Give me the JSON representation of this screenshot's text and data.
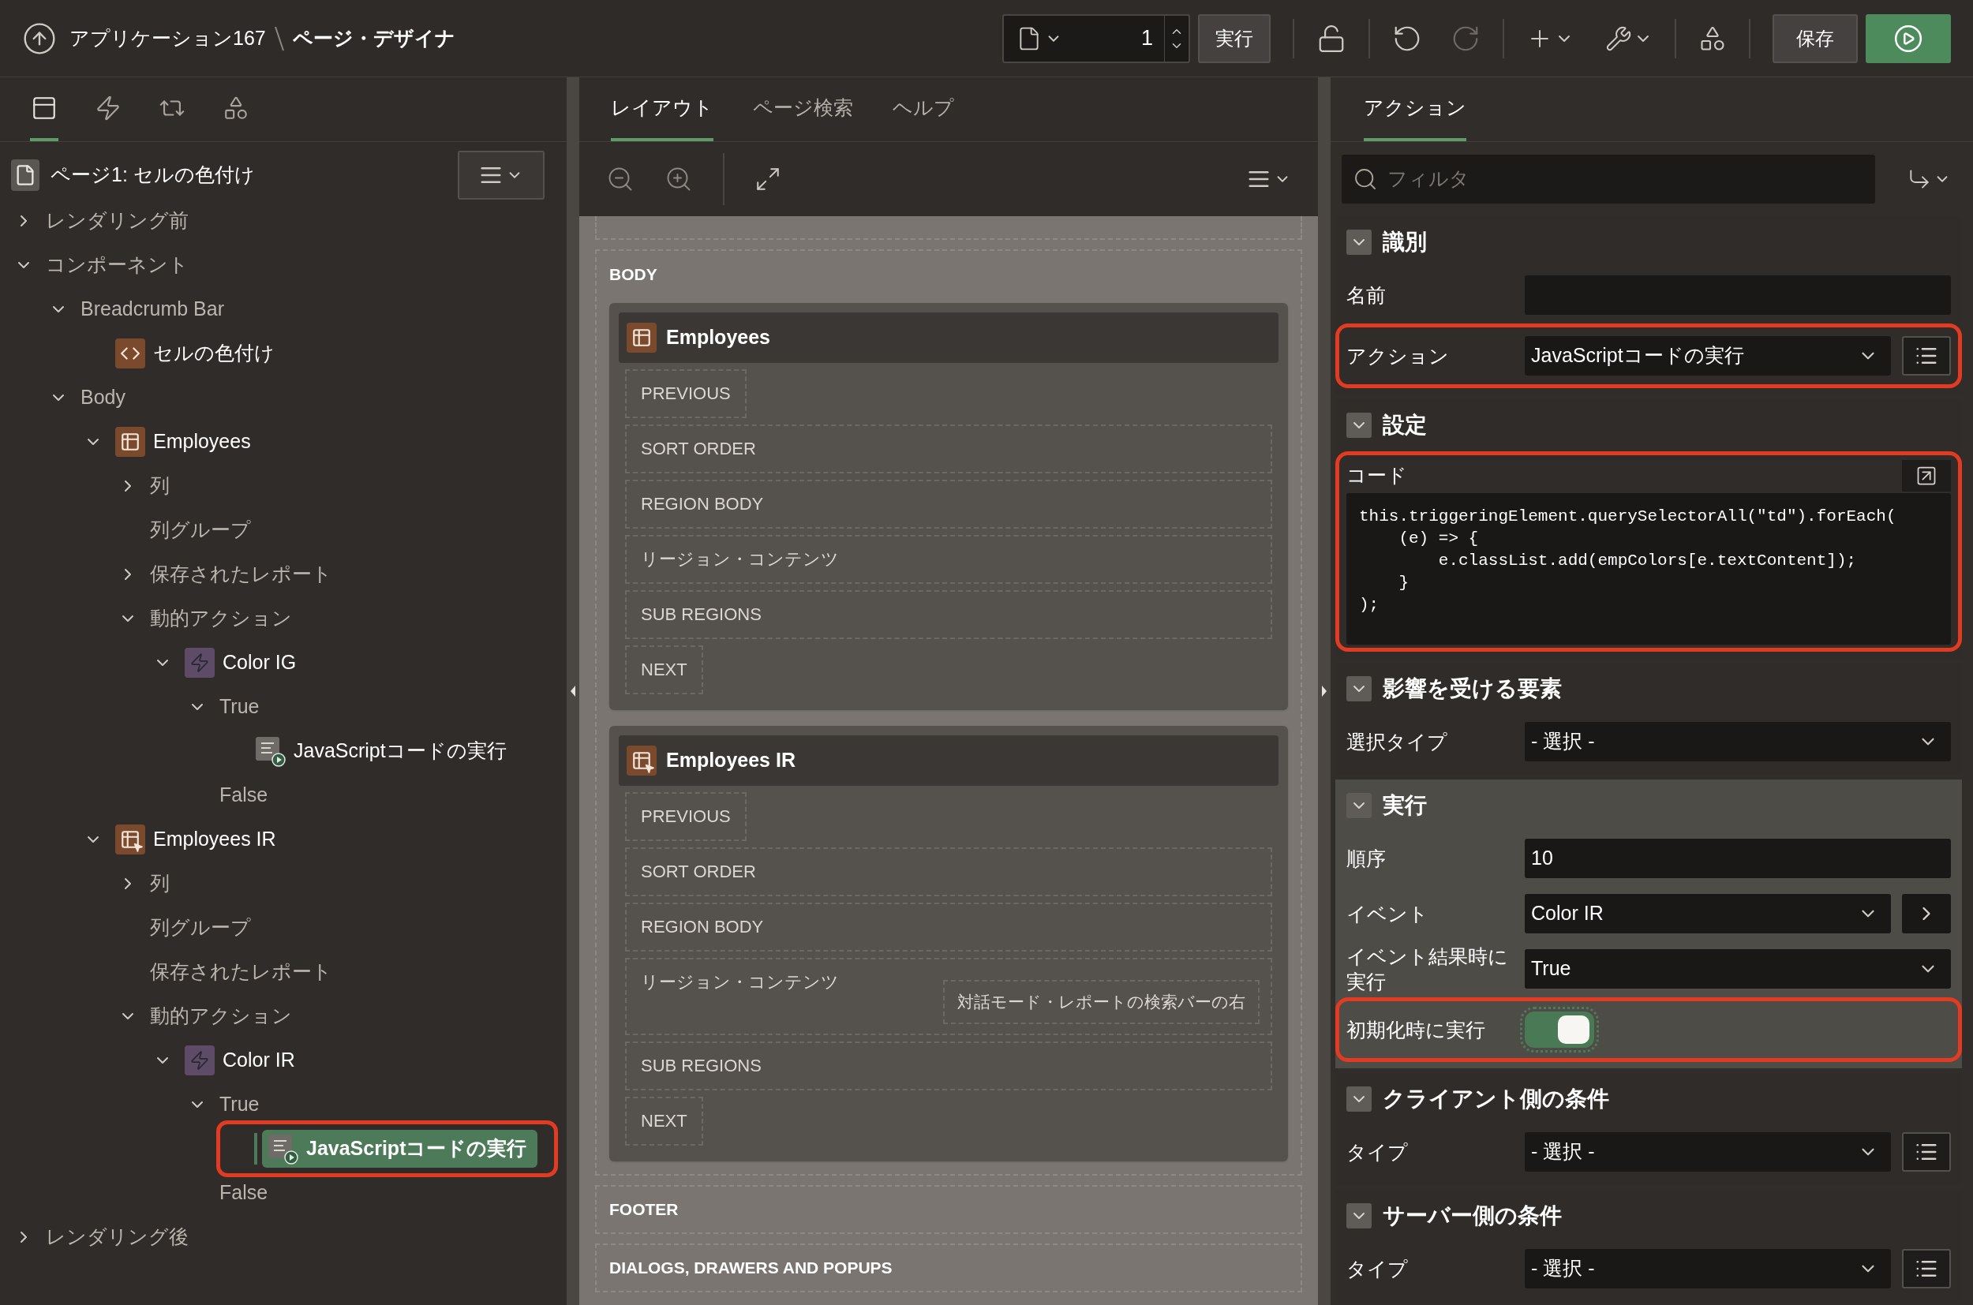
{
  "header": {
    "breadcrumb": [
      {
        "label": "アプリケーション167"
      },
      {
        "label": "ページ・デザイナ"
      }
    ],
    "page_number": "1",
    "run_label": "実行",
    "save_label": "保存"
  },
  "left_panel": {
    "tabs": [
      {
        "kind": "rendering",
        "selected": true
      },
      {
        "kind": "dynamic",
        "selected": false
      },
      {
        "kind": "processing",
        "selected": false
      },
      {
        "kind": "shared",
        "selected": false
      }
    ],
    "page_title": "ページ1: セルの色付け",
    "tree": [
      {
        "label": "レンダリング前",
        "kind": "plain",
        "expanded": false,
        "selected": false
      },
      {
        "label": "コンポーネント",
        "kind": "plain",
        "expanded": true,
        "selected": false,
        "children": [
          {
            "label": "Breadcrumb Bar",
            "kind": "plain",
            "expanded": true,
            "selected": false,
            "children": [
              {
                "label": "セルの色付け",
                "kind": "code",
                "selected": false
              }
            ]
          },
          {
            "label": "Body",
            "kind": "plain",
            "expanded": true,
            "selected": false,
            "children": [
              {
                "label": "Employees",
                "kind": "grid",
                "expanded": true,
                "selected": false,
                "children": [
                  {
                    "label": "列",
                    "kind": "plain",
                    "expanded": false,
                    "selected": false
                  },
                  {
                    "label": "列グループ",
                    "kind": "plain",
                    "selected": false
                  },
                  {
                    "label": "保存されたレポート",
                    "kind": "plain",
                    "expanded": false,
                    "selected": false
                  },
                  {
                    "label": "動的アクション",
                    "kind": "plain",
                    "expanded": true,
                    "selected": false,
                    "children": [
                      {
                        "label": "Color IG",
                        "kind": "action",
                        "expanded": true,
                        "selected": false,
                        "children": [
                          {
                            "label": "True",
                            "kind": "plain",
                            "expanded": true,
                            "selected": false,
                            "children": [
                              {
                                "label": "JavaScriptコードの実行",
                                "kind": "js",
                                "selected": false
                              }
                            ]
                          },
                          {
                            "label": "False",
                            "kind": "plain",
                            "selected": false
                          }
                        ]
                      }
                    ]
                  }
                ]
              },
              {
                "label": "Employees IR",
                "kind": "report",
                "expanded": true,
                "selected": false,
                "children": [
                  {
                    "label": "列",
                    "kind": "plain",
                    "expanded": false,
                    "selected": false
                  },
                  {
                    "label": "列グループ",
                    "kind": "plain",
                    "selected": false
                  },
                  {
                    "label": "保存されたレポート",
                    "kind": "plain",
                    "selected": false
                  },
                  {
                    "label": "動的アクション",
                    "kind": "plain",
                    "expanded": true,
                    "selected": false,
                    "children": [
                      {
                        "label": "Color IR",
                        "kind": "action",
                        "expanded": true,
                        "selected": false,
                        "children": [
                          {
                            "label": "True",
                            "kind": "plain",
                            "expanded": true,
                            "selected": false,
                            "children": [
                              {
                                "label": "JavaScriptコードの実行",
                                "kind": "js",
                                "selected": true,
                                "annotated": true
                              }
                            ]
                          },
                          {
                            "label": "False",
                            "kind": "plain",
                            "selected": false
                          }
                        ]
                      }
                    ]
                  }
                ]
              }
            ]
          }
        ]
      },
      {
        "label": "レンダリング後",
        "kind": "plain",
        "expanded": false,
        "selected": false
      }
    ]
  },
  "center_panel": {
    "tabs": [
      {
        "label": "レイアウト",
        "selected": true
      },
      {
        "label": "ページ検索",
        "selected": false
      },
      {
        "label": "ヘルプ",
        "selected": false
      }
    ],
    "body": {
      "label": "BODY",
      "regions": [
        {
          "title": "Employees",
          "kind": "grid",
          "slots": [
            {
              "label": "PREVIOUS",
              "kind": "button"
            },
            {
              "label": "SORT ORDER",
              "kind": "area"
            },
            {
              "label": "REGION BODY",
              "kind": "area"
            },
            {
              "label": "リージョン・コンテンツ",
              "kind": "area"
            },
            {
              "label": "SUB REGIONS",
              "kind": "area"
            },
            {
              "label": "NEXT",
              "kind": "button"
            }
          ]
        },
        {
          "title": "Employees IR",
          "kind": "report",
          "slots": [
            {
              "label": "PREVIOUS",
              "kind": "button"
            },
            {
              "label": "SORT ORDER",
              "kind": "area"
            },
            {
              "label": "REGION BODY",
              "kind": "area"
            },
            {
              "label": "リージョン・コンテンツ",
              "kind": "area",
              "children": [
                {
                  "label": "対話モード・レポートの検索バーの右"
                }
              ]
            },
            {
              "label": "SUB REGIONS",
              "kind": "area"
            },
            {
              "label": "NEXT",
              "kind": "button"
            }
          ]
        }
      ]
    },
    "after": [
      {
        "label": "FOOTER"
      },
      {
        "label": "DIALOGS, DRAWERS AND POPUPS"
      }
    ]
  },
  "right_panel": {
    "tabs": [
      {
        "label": "アクション",
        "selected": true
      }
    ],
    "filter_placeholder": "フィルタ",
    "sections": [
      {
        "title": "識別",
        "expanded": true,
        "current": false,
        "fields": [
          {
            "label": "名前",
            "kind": "text"
          },
          {
            "label": "アクション",
            "kind": "selectlist",
            "value": "JavaScriptコードの実行",
            "annotated": true
          }
        ]
      },
      {
        "title": "設定",
        "expanded": true,
        "current": false,
        "fields": [
          {
            "label": "コード",
            "kind": "code",
            "value": "this.triggeringElement.querySelectorAll(\"td\").forEach(\n    (e) => {\n        e.classList.add(empColors[e.textContent]);\n    }\n);",
            "annotated": true
          }
        ]
      },
      {
        "title": "影響を受ける要素",
        "expanded": true,
        "current": false,
        "fields": [
          {
            "label": "選択タイプ",
            "kind": "select",
            "value": "- 選択 -"
          }
        ]
      },
      {
        "title": "実行",
        "expanded": true,
        "current": true,
        "fields": [
          {
            "label": "順序",
            "kind": "text",
            "value": "10"
          },
          {
            "label": "イベント",
            "kind": "selectnext",
            "value": "Color IR"
          },
          {
            "label": "イベント結果時に実行",
            "kind": "select",
            "value": "True"
          },
          {
            "label": "初期化時に実行",
            "kind": "switch",
            "on": true,
            "annotated": true
          }
        ]
      },
      {
        "title": "クライアント側の条件",
        "expanded": true,
        "current": false,
        "fields": [
          {
            "label": "タイプ",
            "kind": "selectlist",
            "value": "- 選択 -"
          }
        ]
      },
      {
        "title": "サーバー側の条件",
        "expanded": true,
        "current": false,
        "fields": [
          {
            "label": "タイプ",
            "kind": "selectlist",
            "value": "- 選択 -"
          }
        ]
      }
    ]
  }
}
